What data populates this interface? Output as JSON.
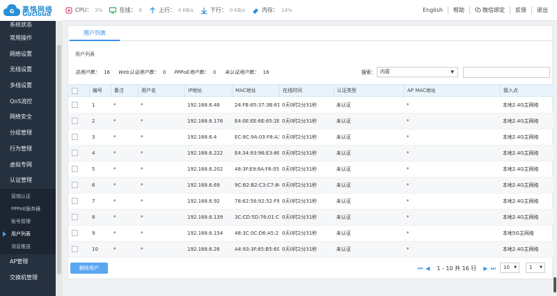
{
  "brand": {
    "cn": "高恪网络",
    "en": "Gocloud"
  },
  "status": {
    "cpu_label": "CPU：",
    "cpu_val": "2%",
    "online_label": "在线：",
    "online_val": "0",
    "up_label": "上行：",
    "up_val": "0 KB/s",
    "down_label": "下行：",
    "down_val": "0 KB/s",
    "mem_label": "内存：",
    "mem_val": "14%"
  },
  "header_links": {
    "lang": "English",
    "help": "帮助",
    "wechat": "微信绑定",
    "feedback": "反馈",
    "logout": "退出"
  },
  "sidebar": {
    "items": [
      "系统状态",
      "常用操作",
      "网络设置",
      "无线设置",
      "多线设置",
      "QoS流控",
      "网络安全",
      "分组管理",
      "行为管理",
      "虚拟专网",
      "认证管理"
    ],
    "sub_items": [
      "营销认证",
      "PPPoE服务器",
      "账号管理",
      "用户列表",
      "消息推送"
    ],
    "bottom_items": [
      "AP管理",
      "交换机管理"
    ]
  },
  "tab": {
    "label": "用户列表"
  },
  "breadcrumb": "用户列表",
  "summary": {
    "total_label": "总用户数：",
    "total": "16",
    "web_label": "Web认证用户数：",
    "web": "0",
    "pppoe_label": "PPPoE用户数：",
    "pppoe": "0",
    "unauth_label": "未认证用户数：",
    "unauth": "16"
  },
  "search": {
    "label": "搜索：",
    "select": "内容",
    "value": ""
  },
  "table": {
    "headers": [
      "编号",
      "备注",
      "用户名",
      "IP地址",
      "MAC地址",
      "在线时间",
      "认证类型",
      "AP MAC地址",
      "接入点"
    ],
    "rows": [
      [
        "1",
        "*",
        "*",
        "192.168.6.46",
        "24:FB:65:37:3B:81",
        "0天0时2分31秒",
        "未认证",
        "*",
        "本地2.4G主网络"
      ],
      [
        "2",
        "*",
        "*",
        "192.168.6.176",
        "E4:0E:EE:6E:65:2E",
        "0天0时2分31秒",
        "未认证",
        "*",
        "本地2.4G主网络"
      ],
      [
        "3",
        "*",
        "*",
        "192.168.6.4",
        "EC:8C:9A:03:F8:A3",
        "0天0时2分31秒",
        "未认证",
        "*",
        "本地2.4G主网络"
      ],
      [
        "4",
        "*",
        "*",
        "192.168.6.222",
        "E4:34:93:96:E3:8E",
        "0天0时2分31秒",
        "未认证",
        "*",
        "本地2.4G主网络"
      ],
      [
        "5",
        "*",
        "*",
        "192.168.6.202",
        "48:3F:E9:8A:F6:05",
        "0天0时2分31秒",
        "未认证",
        "*",
        "本地2.4G主网络"
      ],
      [
        "6",
        "*",
        "*",
        "192.168.6.69",
        "9C:B2:B2:C3:C7:88",
        "0天0时2分31秒",
        "未认证",
        "*",
        "本地2.4G主网络"
      ],
      [
        "7",
        "*",
        "*",
        "192.168.6.92",
        "78:62:56:92:52:F9",
        "0天0时2分31秒",
        "未认证",
        "*",
        "本地2.4G主网络"
      ],
      [
        "8",
        "*",
        "*",
        "192.168.6.139",
        "3C:CD:5D:76:01:CA",
        "0天0时2分31秒",
        "未认证",
        "*",
        "本地2.4G主网络"
      ],
      [
        "9",
        "*",
        "*",
        "192.168.6.154",
        "48:3C:0C:D6:A5:27",
        "0天0时2分31秒",
        "未认证",
        "*",
        "本地5G主网络"
      ],
      [
        "10",
        "*",
        "*",
        "192.168.6.26",
        "A4:93:3F:85:B5:60",
        "0天0时2分31秒",
        "未认证",
        "*",
        "本地2.4G主网络"
      ]
    ]
  },
  "footer": {
    "delete_label": "删除用户",
    "range": "1 - 10 共 16 行",
    "page_size": "10",
    "page": "1"
  },
  "colors": {
    "accent": "#3a8ee6",
    "sidebar_bg": "#263140",
    "header_bg": "#e8f3fb"
  }
}
